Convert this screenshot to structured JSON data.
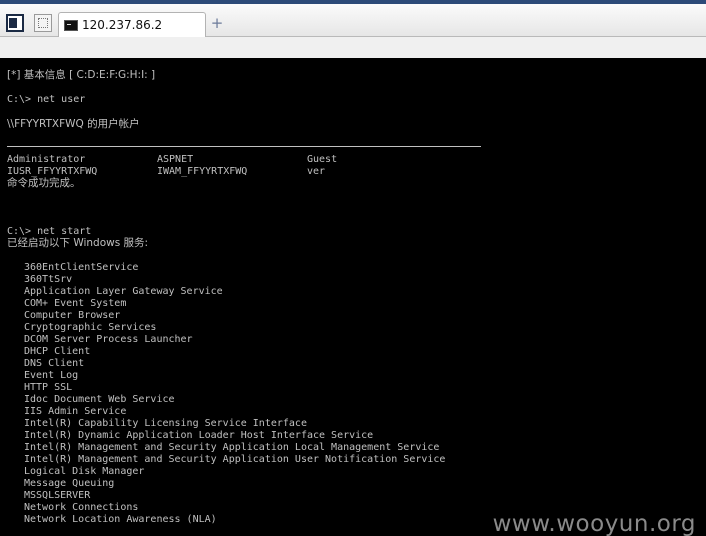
{
  "tabs": {
    "active_title": "120.237.86.2",
    "new_tab_symbol": "+"
  },
  "console": {
    "info_header": "[*] 基本信息 [ C:D:E:F:G:H:I: ]",
    "cmd_net_user": "C:\\> net user",
    "user_accounts_title": "\\\\FFYYRTXFWQ 的用户帐户",
    "users": [
      [
        "Administrator",
        "ASPNET",
        "Guest"
      ],
      [
        "IUSR_FFYYRTXFWQ",
        "IWAM_FFYYRTXFWQ",
        "ver"
      ]
    ],
    "success_message": "命令成功完成。",
    "cmd_net_start": "C:\\> net start",
    "services_header": "已经启动以下 Windows 服务:",
    "services": [
      "360EntClientService",
      "360TtSrv",
      "Application Layer Gateway Service",
      "COM+ Event System",
      "Computer Browser",
      "Cryptographic Services",
      "DCOM Server Process Launcher",
      "DHCP Client",
      "DNS Client",
      "Event Log",
      "HTTP SSL",
      "Idoc Document Web Service",
      "IIS Admin Service",
      "Intel(R) Capability Licensing Service Interface",
      "Intel(R) Dynamic Application Loader Host Interface Service",
      "Intel(R) Management and Security Application Local Management Service",
      "Intel(R) Management and Security Application User Notification Service",
      "Logical Disk Manager",
      "Message Queuing",
      "MSSQLSERVER",
      "Network Connections",
      "Network Location Awareness (NLA)"
    ]
  },
  "watermark": "www.wooyun.org"
}
